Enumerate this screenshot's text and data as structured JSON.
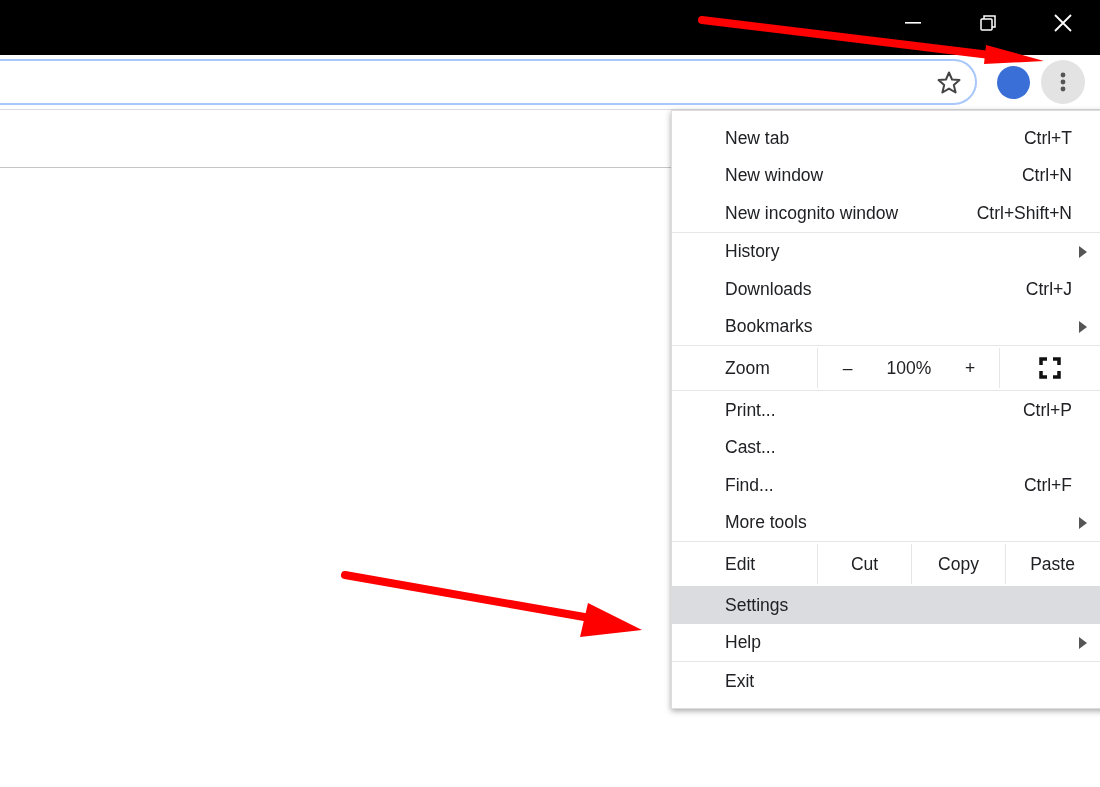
{
  "menu": {
    "sections": [
      {
        "items": [
          {
            "kind": "item",
            "label": "New tab",
            "shortcut": "Ctrl+T",
            "submenu": false,
            "highlighted": false
          },
          {
            "kind": "item",
            "label": "New window",
            "shortcut": "Ctrl+N",
            "submenu": false,
            "highlighted": false
          },
          {
            "kind": "item",
            "label": "New incognito window",
            "shortcut": "Ctrl+Shift+N",
            "submenu": false,
            "highlighted": false
          }
        ]
      },
      {
        "items": [
          {
            "kind": "item",
            "label": "History",
            "submenu": true,
            "highlighted": false
          },
          {
            "kind": "item",
            "label": "Downloads",
            "shortcut": "Ctrl+J",
            "submenu": false,
            "highlighted": false
          },
          {
            "kind": "item",
            "label": "Bookmarks",
            "submenu": true,
            "highlighted": false
          }
        ]
      },
      {
        "items": [
          {
            "kind": "zoom",
            "label": "Zoom",
            "minus": "–",
            "value": "100%",
            "plus": "+"
          }
        ]
      },
      {
        "items": [
          {
            "kind": "item",
            "label": "Print...",
            "shortcut": "Ctrl+P",
            "submenu": false,
            "highlighted": false
          },
          {
            "kind": "item",
            "label": "Cast...",
            "submenu": false,
            "highlighted": false
          },
          {
            "kind": "item",
            "label": "Find...",
            "shortcut": "Ctrl+F",
            "submenu": false,
            "highlighted": false
          },
          {
            "kind": "item",
            "label": "More tools",
            "submenu": true,
            "highlighted": false
          }
        ]
      },
      {
        "items": [
          {
            "kind": "edit",
            "label": "Edit",
            "buttons": [
              "Cut",
              "Copy",
              "Paste"
            ]
          },
          {
            "kind": "item",
            "label": "Settings",
            "submenu": false,
            "highlighted": true
          },
          {
            "kind": "item",
            "label": "Help",
            "submenu": true,
            "highlighted": false
          }
        ]
      },
      {
        "items": [
          {
            "kind": "item",
            "label": "Exit",
            "submenu": false,
            "highlighted": false
          }
        ]
      }
    ]
  }
}
